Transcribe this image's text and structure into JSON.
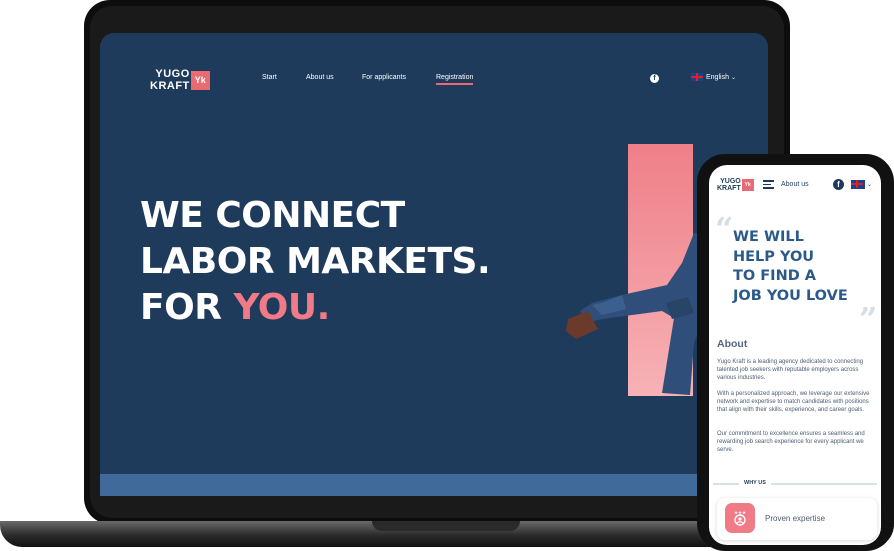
{
  "laptop": {
    "logo": {
      "line1": "YUGO",
      "line2": "KRAFT",
      "badge": "Yk"
    },
    "nav": {
      "start": "Start",
      "about": "About us",
      "applicants": "For applicants",
      "registration": "Registration"
    },
    "social_icon": "facebook-icon",
    "language": "English",
    "hero": {
      "line1": "WE CONNECT",
      "line2": "LABOR MARKETS.",
      "line3_prefix": "FOR ",
      "line3_accent": "YOU."
    },
    "colors": {
      "background": "#1f3b5c",
      "accent": "#e86b74"
    }
  },
  "phone": {
    "logo": {
      "line1": "YUGO",
      "line2": "KRAFT",
      "badge": "Yk"
    },
    "menu_label": "About us",
    "hero": {
      "line1": "WE WILL",
      "line2": "HELP YOU",
      "line3": "TO FIND A",
      "line4": "JOB YOU LOVE"
    },
    "about_title": "About",
    "about_p1": " Yugo Kraft is a leading  agency dedicated to connecting talented job seekers with reputable employers across various industries.",
    "about_p2": "With a personalized approach, we leverage our extensive network and expertise to match candidates with positions that align with their skills, experience, and career goals.",
    "about_p3": "Our commitment to excellence ensures a seamless and rewarding job search experience for every applicant we serve.",
    "why_us": "WHY US",
    "card_label": "Proven expertise"
  }
}
